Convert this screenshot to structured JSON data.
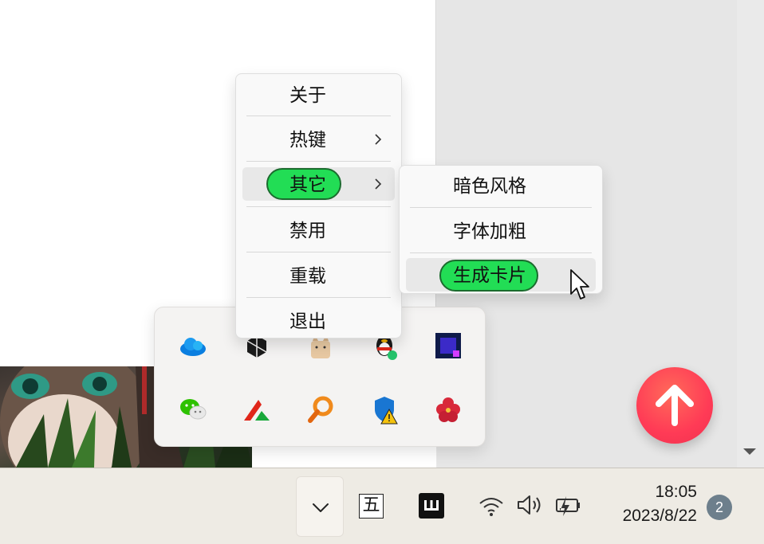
{
  "context_menu": {
    "items": [
      {
        "label": "关于",
        "has_submenu": false
      },
      {
        "label": "热键",
        "has_submenu": true
      },
      {
        "label": "其它",
        "has_submenu": true,
        "active": true
      },
      {
        "label": "禁用",
        "has_submenu": false
      },
      {
        "label": "重载",
        "has_submenu": false
      },
      {
        "label": "退出",
        "has_submenu": false
      }
    ]
  },
  "submenu": {
    "items": [
      {
        "label": "暗色风格"
      },
      {
        "label": "字体加粗"
      },
      {
        "label": "生成卡片",
        "active": true
      }
    ]
  },
  "tray_flyout": {
    "icons": [
      "onedrive-icon",
      "app-cube-icon",
      "cat-app-icon",
      "qq-icon",
      "purple-square-app-icon",
      "wechat-icon",
      "red-green-arrow-app-icon",
      "magnifier-app-icon",
      "security-warning-shield-icon",
      "red-flower-app-icon"
    ]
  },
  "taskbar": {
    "ime_label": "五",
    "time": "18:05",
    "date": "2023/8/22",
    "notification_count": "2"
  },
  "colors": {
    "highlight_pill": "#22dd55",
    "fab": "#ff3b56"
  }
}
